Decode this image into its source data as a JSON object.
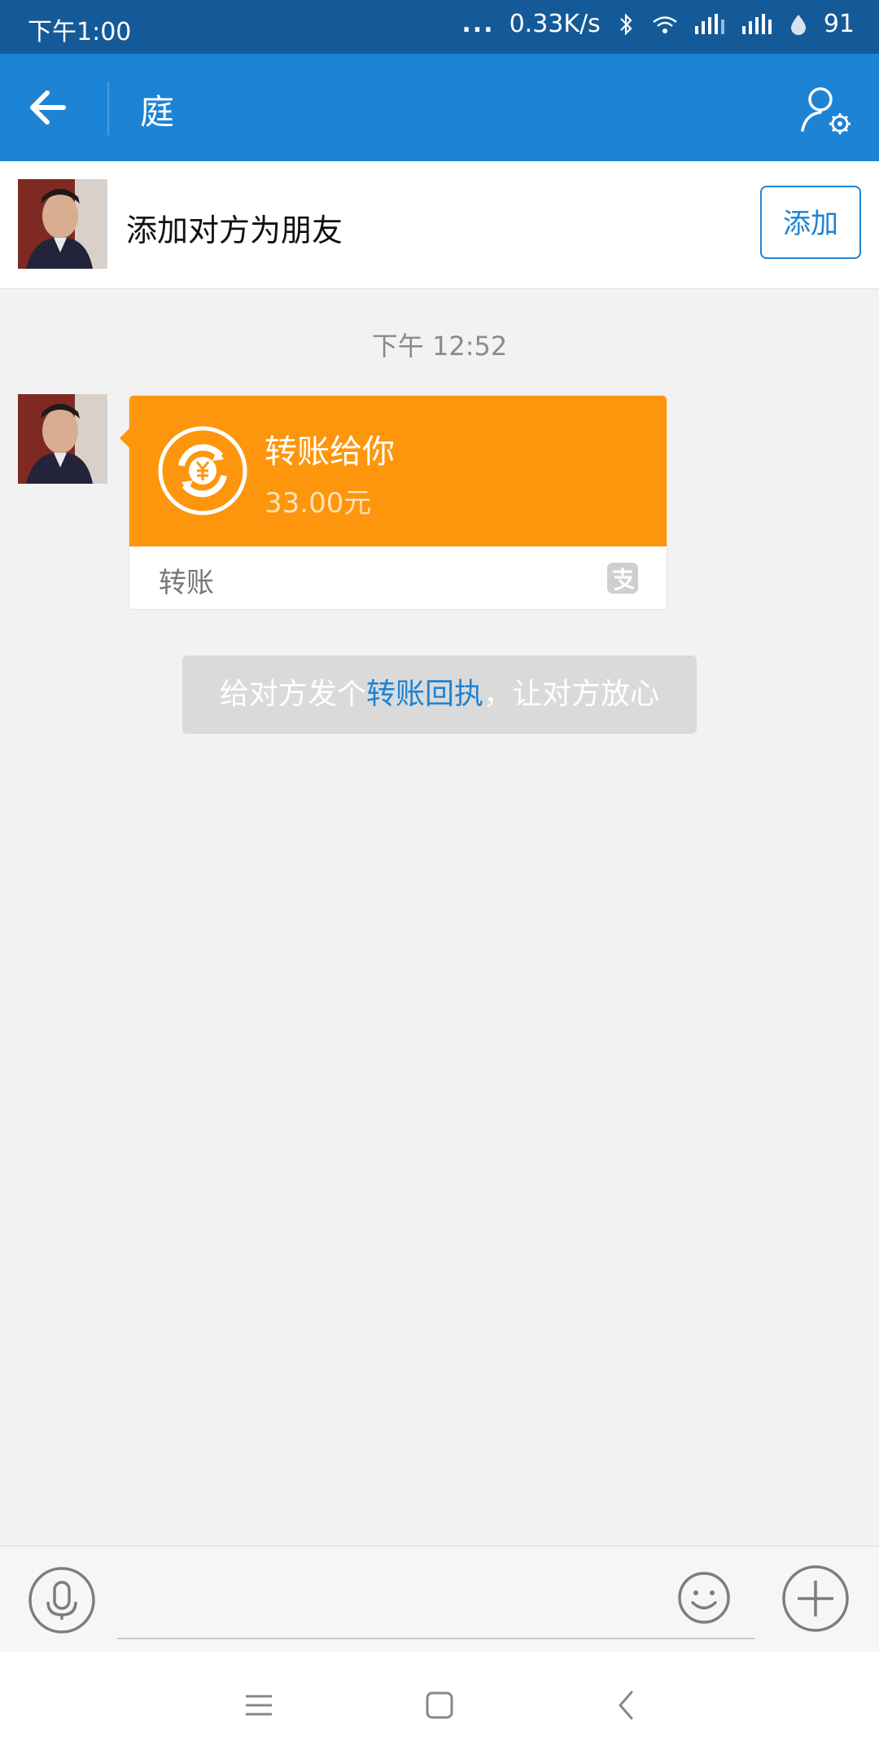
{
  "status_bar": {
    "time": "下午1:00",
    "dots": "...",
    "network_speed": "0.33K/s",
    "battery": "91"
  },
  "nav": {
    "title": "庭"
  },
  "friend_bar": {
    "text": "添加对方为朋友",
    "add_button": "添加"
  },
  "chat": {
    "timestamp": "下午 12:52",
    "transfer": {
      "title": "转账给你",
      "amount": "33.00元",
      "label": "转账"
    },
    "receipt_tip": {
      "prefix": "给对方发个",
      "link": "转账回执",
      "suffix": "，让对方放心"
    }
  },
  "input_bar": {
    "value": "",
    "placeholder": ""
  },
  "colors": {
    "status_bar": "#155a98",
    "nav_bar": "#1d83d4",
    "transfer_card": "#fd960c",
    "link": "#1d83d4"
  },
  "icons": [
    "back-arrow-icon",
    "profile-settings-icon",
    "yuan-transfer-icon",
    "alipay-icon",
    "voice-icon",
    "emoji-icon",
    "plus-icon",
    "menu-icon",
    "home-icon",
    "back-icon"
  ]
}
